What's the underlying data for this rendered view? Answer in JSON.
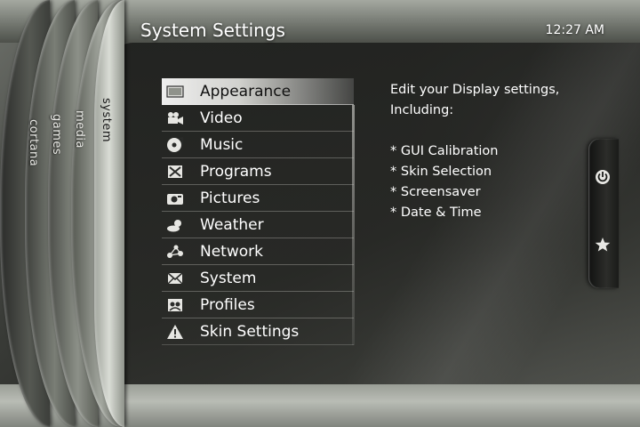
{
  "header": {
    "title": "System Settings",
    "clock": "12:27 AM"
  },
  "side_tabs": [
    {
      "label": "cortana",
      "active": false
    },
    {
      "label": "games",
      "active": false
    },
    {
      "label": "media",
      "active": false
    },
    {
      "label": "system",
      "active": true
    }
  ],
  "menu": {
    "selected_index": 0,
    "items": [
      {
        "label": "Appearance",
        "icon": "display-icon"
      },
      {
        "label": "Video",
        "icon": "video-camera-icon"
      },
      {
        "label": "Music",
        "icon": "music-disc-icon"
      },
      {
        "label": "Programs",
        "icon": "programs-icon"
      },
      {
        "label": "Pictures",
        "icon": "camera-icon"
      },
      {
        "label": "Weather",
        "icon": "weather-icon"
      },
      {
        "label": "Network",
        "icon": "network-icon"
      },
      {
        "label": "System",
        "icon": "system-icon"
      },
      {
        "label": "Profiles",
        "icon": "profiles-icon"
      },
      {
        "label": "Skin Settings",
        "icon": "warning-triangle-icon"
      }
    ]
  },
  "description": {
    "intro_1": "Edit your Display settings,",
    "intro_2": "Including:",
    "bullets": [
      "* GUI Calibration",
      "* Skin Selection",
      "* Screensaver",
      "* Date & Time"
    ]
  },
  "right_pod": {
    "buttons": [
      {
        "icon": "power-icon"
      },
      {
        "icon": "star-icon"
      }
    ]
  },
  "colors": {
    "text": "#ffffff",
    "selected_text": "#111111",
    "panel_dark": "#262724"
  }
}
